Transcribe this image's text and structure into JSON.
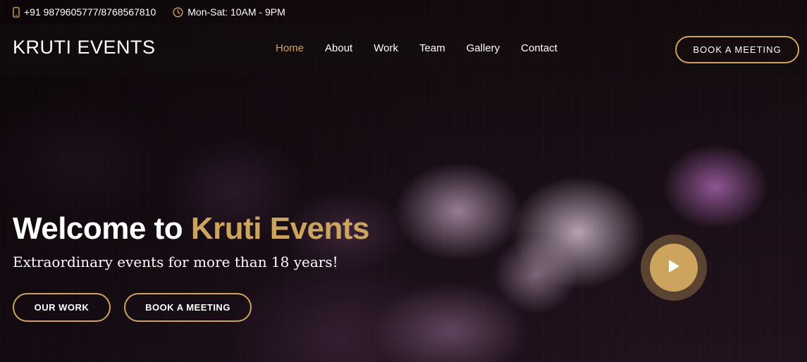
{
  "topbar": {
    "phone": "+91 9879605777/8768567810",
    "hours": "Mon-Sat: 10AM - 9PM",
    "phone_icon": "phone-icon",
    "clock_icon": "clock-icon"
  },
  "header": {
    "logo": "KRUTI EVENTS",
    "nav": [
      {
        "label": "Home",
        "active": true
      },
      {
        "label": "About",
        "active": false
      },
      {
        "label": "Work",
        "active": false
      },
      {
        "label": "Team",
        "active": false
      },
      {
        "label": "Gallery",
        "active": false
      },
      {
        "label": "Contact",
        "active": false
      }
    ],
    "cta": "BOOK A MEETING"
  },
  "hero": {
    "title_prefix": "Welcome to ",
    "title_accent": "Kruti Events",
    "subtitle": "Extraordinary events for more than 18 years!",
    "btn_work": "OUR WORK",
    "btn_meeting": "BOOK A MEETING",
    "play_icon": "play-icon"
  },
  "colors": {
    "accent": "#cda45e",
    "text": "#ffffff"
  }
}
